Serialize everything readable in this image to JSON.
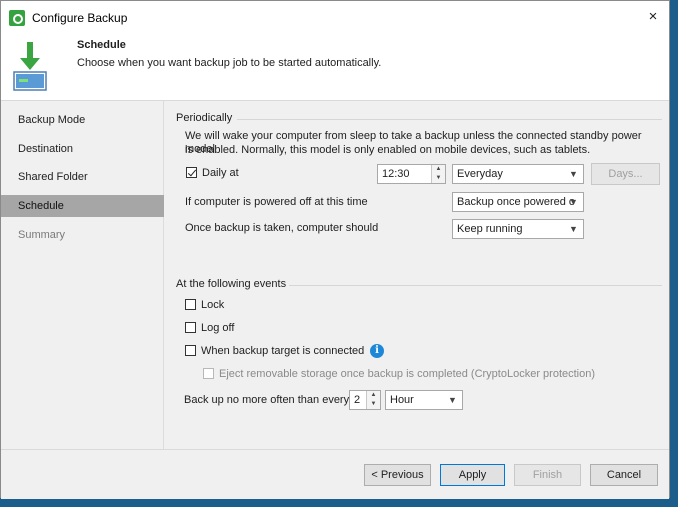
{
  "window": {
    "title": "Configure Backup",
    "close": "×"
  },
  "header": {
    "step_title": "Schedule",
    "step_description": "Choose when you want backup job to be started automatically."
  },
  "nav": {
    "items": [
      {
        "label": "Backup Mode",
        "state": "normal"
      },
      {
        "label": "Destination",
        "state": "normal"
      },
      {
        "label": "Shared Folder",
        "state": "normal"
      },
      {
        "label": "Schedule",
        "state": "active"
      },
      {
        "label": "Summary",
        "state": "disabled"
      }
    ]
  },
  "periodically": {
    "group_label": "Periodically",
    "description_line1": "We will wake your computer from sleep to take a backup unless the connected standby power model",
    "description_line2": "is enabled. Normally, this model is only enabled on mobile devices, such as tablets.",
    "daily_label": "Daily at",
    "daily_checked": true,
    "time_value": "12:30",
    "frequency_value": "Everyday",
    "days_button": "Days...",
    "powered_off_label": "If computer is powered off at this time",
    "powered_off_value": "Backup once powered o",
    "after_backup_label": "Once backup is taken, computer should",
    "after_backup_value": "Keep running"
  },
  "events": {
    "group_label": "At the following events",
    "lock_label": "Lock",
    "lock_checked": false,
    "logoff_label": "Log off",
    "logoff_checked": false,
    "target_label": "When backup target is connected",
    "target_checked": false,
    "eject_label": "Eject removable storage once backup is completed (CryptoLocker protection)",
    "eject_checked": false,
    "limit_label": "Back up no more often than every",
    "limit_value": "2",
    "limit_unit": "Hour"
  },
  "footer": {
    "previous": "< Previous",
    "apply": "Apply",
    "finish": "Finish",
    "cancel": "Cancel"
  },
  "colors": {
    "accent": "#0078d7",
    "brand_green": "#34a23e",
    "nav_active": "#a6a6a6",
    "info": "#1e88d8"
  }
}
